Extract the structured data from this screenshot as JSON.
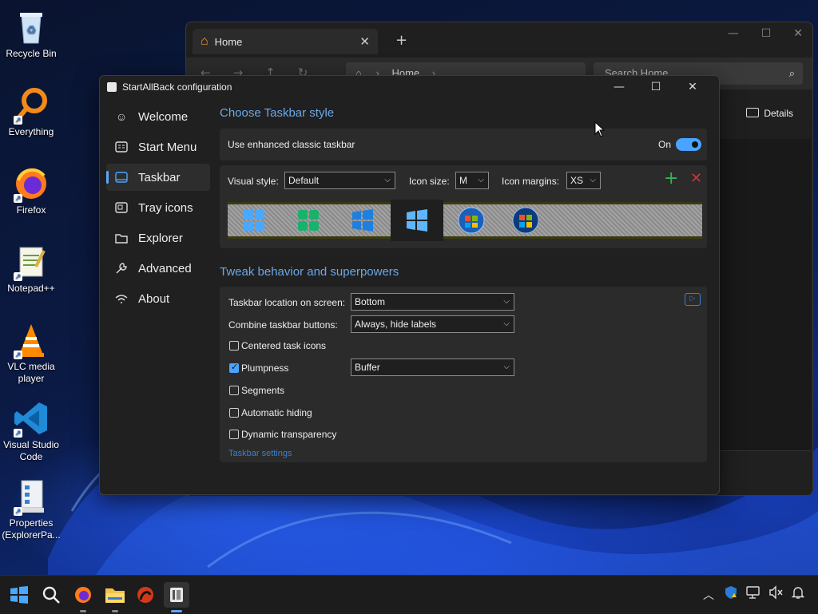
{
  "desktop": {
    "icons": [
      {
        "label": "Recycle Bin",
        "icon": "recycle-bin-icon"
      },
      {
        "label": "Everything",
        "icon": "everything-search-icon"
      },
      {
        "label": "Firefox",
        "icon": "firefox-icon"
      },
      {
        "label": "Notepad++",
        "icon": "notepad-plus-plus-icon"
      },
      {
        "label": "VLC media player",
        "icon": "vlc-icon"
      },
      {
        "label": "Visual Studio Code",
        "icon": "vscode-icon"
      },
      {
        "label": "Properties (ExplorerPa...",
        "icon": "properties-icon"
      }
    ]
  },
  "explorer": {
    "tab_title": "Home",
    "address": "Home",
    "search_placeholder": "Search Home",
    "details_label": "Details"
  },
  "sab": {
    "title": "StartAllBack configuration",
    "nav": [
      {
        "label": "Welcome",
        "icon": "smile-icon"
      },
      {
        "label": "Start Menu",
        "icon": "start-menu-icon"
      },
      {
        "label": "Taskbar",
        "icon": "taskbar-icon"
      },
      {
        "label": "Tray icons",
        "icon": "tray-icon"
      },
      {
        "label": "Explorer",
        "icon": "folder-icon"
      },
      {
        "label": "Advanced",
        "icon": "wrench-icon"
      },
      {
        "label": "About",
        "icon": "about-icon"
      }
    ],
    "active_nav": "Taskbar",
    "section1_title": "Choose Taskbar style",
    "enhanced_label": "Use enhanced classic taskbar",
    "enhanced_state": "On",
    "visual_style_label": "Visual style:",
    "visual_style_value": "Default",
    "icon_size_label": "Icon size:",
    "icon_size_value": "M",
    "icon_margins_label": "Icon margins:",
    "icon_margins_value": "XS",
    "styles": [
      "win11",
      "win-green",
      "win10",
      "win8",
      "win7-orb",
      "vista-orb"
    ],
    "selected_style_index": 3,
    "section2_title": "Tweak behavior and superpowers",
    "location_label": "Taskbar location on screen:",
    "location_value": "Bottom",
    "combine_label": "Combine taskbar buttons:",
    "combine_value": "Always, hide labels",
    "options": [
      {
        "label": "Centered task icons",
        "checked": false
      },
      {
        "label": "Plumpness",
        "checked": true
      },
      {
        "label": "Segments",
        "checked": false
      },
      {
        "label": "Automatic hiding",
        "checked": false
      },
      {
        "label": "Dynamic transparency",
        "checked": false
      }
    ],
    "plumpness_value": "Buffer",
    "taskbar_settings_link": "Taskbar settings"
  },
  "taskbar": {
    "items": [
      "start-icon",
      "search-icon",
      "firefox-icon",
      "file-explorer-icon",
      "app-icon",
      "startallback-icon"
    ],
    "tray": [
      "chevron-up-icon",
      "security-icon",
      "network-icon",
      "volume-mute-icon",
      "notification-icon"
    ]
  },
  "colors": {
    "accent": "#4aa3ff",
    "section_title": "#6aa7e8",
    "link": "#3a7fd0"
  }
}
